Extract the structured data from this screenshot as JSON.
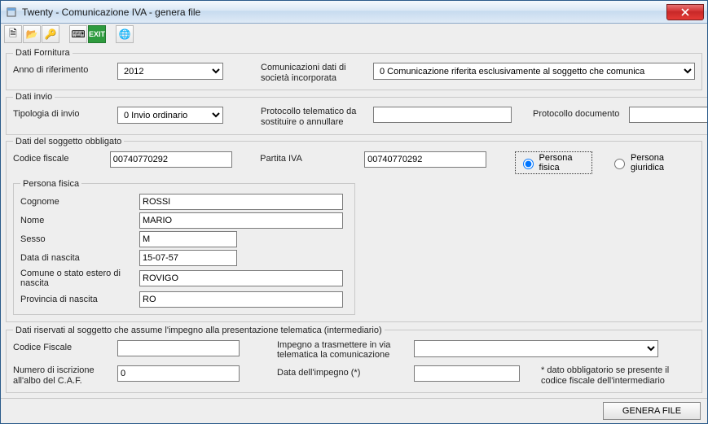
{
  "window": {
    "title": "Twenty - Comunicazione IVA - genera file"
  },
  "toolbar": {
    "icons": [
      "document-icon",
      "folder-open-icon",
      "key-icon",
      "keyboard-icon",
      "exit-icon",
      "globe-icon"
    ],
    "exit_label": "EXIT"
  },
  "fornitura": {
    "legend": "Dati Fornitura",
    "anno_label": "Anno di riferimento",
    "anno_value": "2012",
    "comunicazioni_label": "Comunicazioni dati di società incorporata",
    "comunicazioni_value": "0 Comunicazione riferita esclusivamente al soggetto che comunica"
  },
  "invio": {
    "legend": "Dati invio",
    "tipologia_label": "Tipologia di invio",
    "tipologia_value": "0 Invio ordinario",
    "protocollo_tel_label": "Protocollo telematico da sostituire o annullare",
    "protocollo_tel_value": "",
    "protocollo_doc_label": "Protocollo documento",
    "protocollo_doc_value": ""
  },
  "soggetto": {
    "legend": "Dati del soggetto obbligato",
    "codice_fiscale_label": "Codice fiscale",
    "codice_fiscale_value": "00740770292",
    "partita_iva_label": "Partita IVA",
    "partita_iva_value": "00740770292",
    "radio_fisica": "Persona fisica",
    "radio_giuridica": "Persona giuridica",
    "persona": {
      "legend": "Persona fisica",
      "cognome_label": "Cognome",
      "cognome_value": "ROSSI",
      "nome_label": "Nome",
      "nome_value": "MARIO",
      "sesso_label": "Sesso",
      "sesso_value": "M",
      "data_nascita_label": "Data di nascita",
      "data_nascita_value": "15-07-57",
      "comune_label": "Comune o stato estero di nascita",
      "comune_value": "ROVIGO",
      "provincia_label": "Provincia di nascita",
      "provincia_value": "RO"
    }
  },
  "intermediario": {
    "legend": "Dati riservati al soggetto che assume l'impegno alla presentazione telematica (intermediario)",
    "codice_fiscale_label": "Codice Fiscale",
    "codice_fiscale_value": "",
    "impegno_label": "Impegno a trasmettere in via telematica la comunicazione",
    "impegno_value": "",
    "numero_label": "Numero di iscrizione all'albo del C.A.F.",
    "numero_value": "0",
    "data_impegno_label": "Data dell'impegno (*)",
    "data_impegno_value": "",
    "note": "* dato obbligatorio se presente il codice fiscale dell'intermediario"
  },
  "footer": {
    "genera": "GENERA FILE"
  }
}
